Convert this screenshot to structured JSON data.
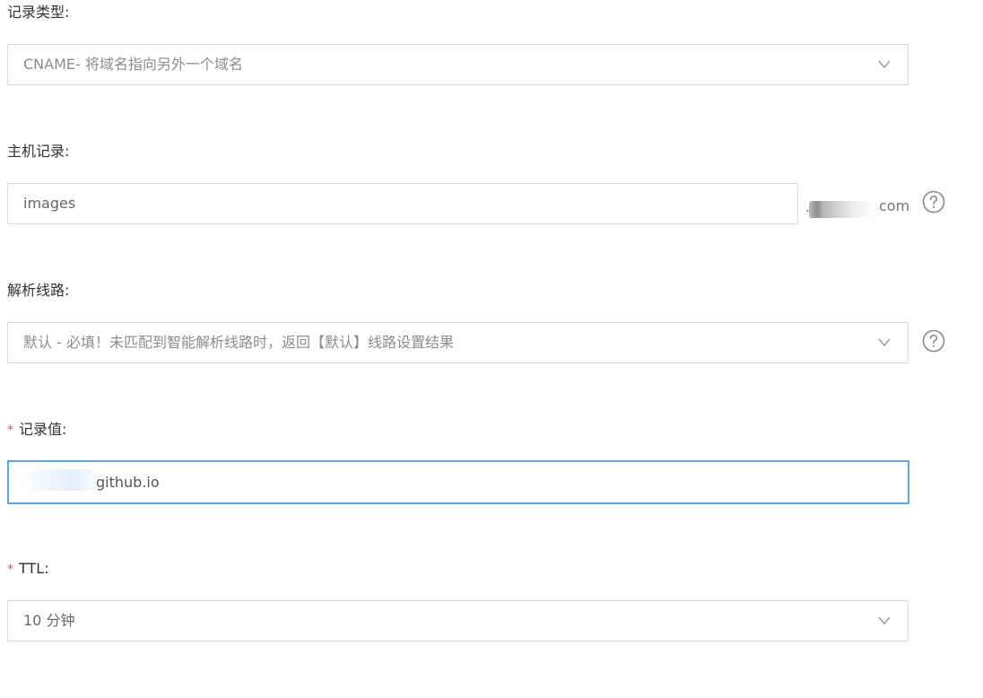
{
  "record_type": {
    "label": "记录类型:",
    "value": "CNAME- 将域名指向另外一个域名"
  },
  "host_record": {
    "label": "主机记录:",
    "value": "images",
    "suffix": "com"
  },
  "line": {
    "label": "解析线路:",
    "value": "默认 - 必填！未匹配到智能解析线路时，返回【默认】线路设置结果"
  },
  "record_value": {
    "required_mark": "*",
    "label": "记录值:",
    "value": "github.io"
  },
  "ttl": {
    "required_mark": "*",
    "label": "TTL:",
    "value": "10 分钟"
  },
  "icons": {
    "dropdown": "chevron-down-icon",
    "help": "help-circle-icon"
  },
  "colors": {
    "focus_border": "#5aa8e8",
    "required": "#d9534f",
    "border": "#d9d9d9"
  }
}
